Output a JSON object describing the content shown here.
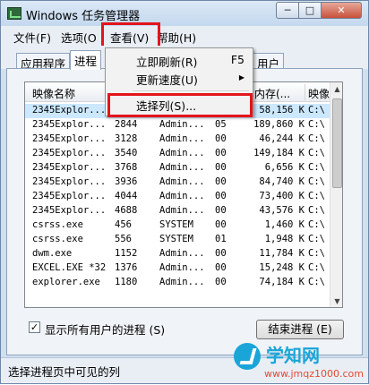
{
  "window": {
    "title": "Windows 任务管理器",
    "minimize_glyph": "─",
    "maximize_glyph": "□",
    "close_glyph": "✕"
  },
  "menu": {
    "file": "文件(F)",
    "options": "选项(O",
    "view": "查看(V)",
    "help": "帮助(H)"
  },
  "tabs": {
    "applications": "应用程序",
    "processes": "进程",
    "users": "用户"
  },
  "view_menu": {
    "items": [
      {
        "label": "立即刷新(R)",
        "shortcut": "F5"
      },
      {
        "label": "更新速度(U)",
        "submenu_arrow": "▶"
      },
      {
        "label": "选择列(S)..."
      }
    ]
  },
  "process_list": {
    "columns": [
      "映像名称",
      "内存(...",
      "映像"
    ],
    "rows": [
      {
        "name": "2345Explor...",
        "pid": "",
        "user": "",
        "cpu": "",
        "mem": "58,156 K",
        "path": "C:\\"
      },
      {
        "name": "2345Explor...",
        "pid": "2844",
        "user": "Admin...",
        "cpu": "05",
        "mem": "189,860 K",
        "path": "C:\\"
      },
      {
        "name": "2345Explor...",
        "pid": "3128",
        "user": "Admin...",
        "cpu": "00",
        "mem": "46,244 K",
        "path": "C:\\"
      },
      {
        "name": "2345Explor...",
        "pid": "3540",
        "user": "Admin...",
        "cpu": "00",
        "mem": "149,184 K",
        "path": "C:\\"
      },
      {
        "name": "2345Explor...",
        "pid": "3768",
        "user": "Admin...",
        "cpu": "00",
        "mem": "6,656 K",
        "path": "C:\\"
      },
      {
        "name": "2345Explor...",
        "pid": "3936",
        "user": "Admin...",
        "cpu": "00",
        "mem": "84,740 K",
        "path": "C:\\"
      },
      {
        "name": "2345Explor...",
        "pid": "4044",
        "user": "Admin...",
        "cpu": "00",
        "mem": "73,400 K",
        "path": "C:\\"
      },
      {
        "name": "2345Explor...",
        "pid": "4688",
        "user": "Admin...",
        "cpu": "00",
        "mem": "43,576 K",
        "path": "C:\\"
      },
      {
        "name": "csrss.exe",
        "pid": "456",
        "user": "SYSTEM",
        "cpu": "00",
        "mem": "1,460 K",
        "path": "C:\\"
      },
      {
        "name": "csrss.exe",
        "pid": "556",
        "user": "SYSTEM",
        "cpu": "01",
        "mem": "1,948 K",
        "path": "C:\\"
      },
      {
        "name": "dwm.exe",
        "pid": "1152",
        "user": "Admin...",
        "cpu": "00",
        "mem": "11,784 K",
        "path": "C:\\"
      },
      {
        "name": "EXCEL.EXE *32",
        "pid": "1376",
        "user": "Admin...",
        "cpu": "00",
        "mem": "15,248 K",
        "path": "C:\\"
      },
      {
        "name": "explorer.exe",
        "pid": "1180",
        "user": "Admin...",
        "cpu": "00",
        "mem": "74,184 K",
        "path": "C:\\"
      }
    ]
  },
  "show_all_users": {
    "label": "显示所有用户的进程 (S)",
    "check_glyph": "✓"
  },
  "end_process_button": "结束进程 (E)",
  "status_text": "选择进程页中可见的列",
  "watermark": {
    "title": "学知网",
    "url": "www.jmqz1000.com"
  },
  "colors": {
    "highlight_box": "#e3141b",
    "accent": "#1aa5d8"
  }
}
